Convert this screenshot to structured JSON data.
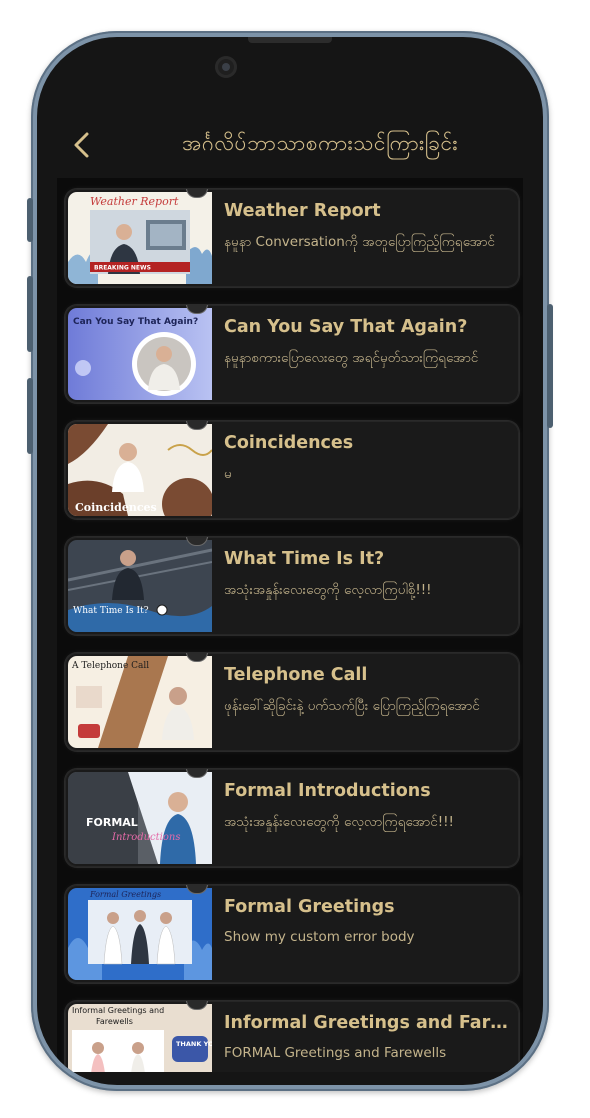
{
  "header": {
    "title": "အင်္ဂလိပ်ဘာသာစကားသင်ကြားခြင်း",
    "back_icon": "chevron-left-icon"
  },
  "colors": {
    "accent": "#d6c08c",
    "background": "#151515",
    "card": "#1a1a1a"
  },
  "lessons": [
    {
      "title": "Weather Report",
      "subtitle": "နမူနာ Conversationကို အတူပြောကြည့်ကြရအောင်",
      "thumb_text": "Weather Report",
      "thumb_tag": "BREAKING NEWS"
    },
    {
      "title": "Can You Say That Again?",
      "subtitle": "နမူနာစကားပြောလေးတွေ အရင်မှတ်သားကြရအောင်",
      "thumb_text": "Can You Say That Again?"
    },
    {
      "title": "Coincidences",
      "subtitle": "မ",
      "thumb_text": "Coincidences"
    },
    {
      "title": "What Time Is It?",
      "subtitle": "အသုံးအနှုန်းလေးတွေကို လေ့လာကြပါစို့!!!",
      "thumb_text": "What Time Is It?"
    },
    {
      "title": "Telephone Call",
      "subtitle": "ဖုန်းခေါ်ဆိုခြင်းနဲ့ ပက်သက်ပြီး ပြောကြည့်ကြရအောင်",
      "thumb_text": "A Telephone Call"
    },
    {
      "title": "Formal Introductions",
      "subtitle": "အသုံးအနှုန်းလေးတွေကို လေ့လာကြရအောင်!!!",
      "thumb_text": "FORMAL",
      "thumb_text2": "Introductions"
    },
    {
      "title": "Formal Greetings",
      "subtitle": "Show my custom error body",
      "thumb_text": "Formal Greetings"
    },
    {
      "title": "Informal Greetings and Farewells",
      "subtitle": "FORMAL Greetings and Farewells",
      "thumb_text": "Informal Greetings and",
      "thumb_text2": "Farewells",
      "thumb_tag": "THANK YOU!"
    }
  ]
}
